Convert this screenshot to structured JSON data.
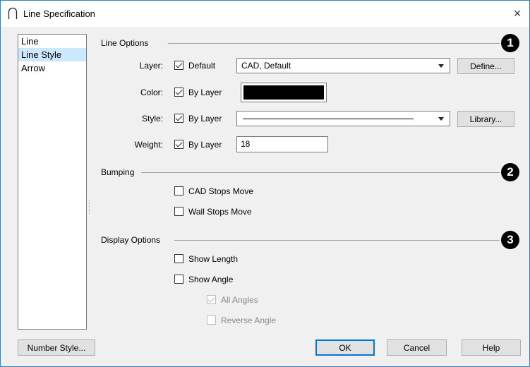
{
  "window": {
    "title": "Line Specification",
    "close_label": "×"
  },
  "nav": {
    "items": [
      {
        "label": "Line",
        "selected": false
      },
      {
        "label": "Line Style",
        "selected": true
      },
      {
        "label": "Arrow",
        "selected": false
      }
    ]
  },
  "line_options": {
    "title": "Line Options",
    "badge": "1",
    "layer": {
      "label": "Layer:",
      "checkbox_label": "Default",
      "checked": true,
      "value": "CAD,  Default",
      "button": "Define..."
    },
    "color": {
      "label": "Color:",
      "checkbox_label": "By Layer",
      "checked": true,
      "swatch_color": "#000000"
    },
    "style": {
      "label": "Style:",
      "checkbox_label": "By Layer",
      "checked": true,
      "button": "Library..."
    },
    "weight": {
      "label": "Weight:",
      "checkbox_label": "By Layer",
      "checked": true,
      "value": "18"
    }
  },
  "bumping": {
    "title": "Bumping",
    "badge": "2",
    "cad_stops_move": {
      "label": "CAD Stops Move",
      "checked": false
    },
    "wall_stops_move": {
      "label": "Wall Stops Move",
      "checked": false
    }
  },
  "display_options": {
    "title": "Display Options",
    "badge": "3",
    "show_length": {
      "label": "Show Length",
      "checked": false
    },
    "show_angle": {
      "label": "Show Angle",
      "checked": false
    },
    "all_angles": {
      "label": "All Angles",
      "checked": true,
      "disabled": true
    },
    "reverse_angle": {
      "label": "Reverse Angle",
      "checked": false,
      "disabled": true
    }
  },
  "footer": {
    "number_style": "Number Style...",
    "ok": "OK",
    "cancel": "Cancel",
    "help": "Help"
  }
}
